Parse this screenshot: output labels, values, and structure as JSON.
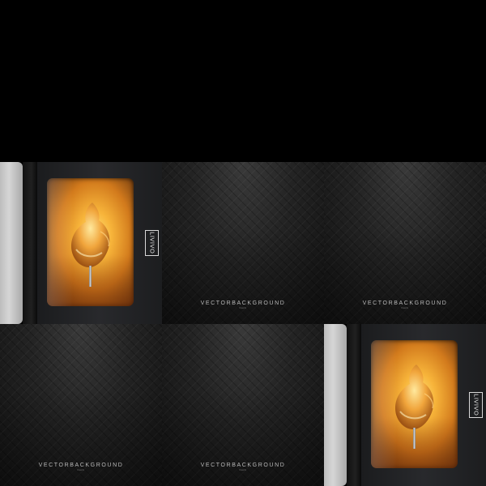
{
  "brand": {
    "logo_text": "LIVIVO"
  },
  "watermark": {
    "main": "VECTORBACKGROUND",
    "sub": "back"
  },
  "tiles": [
    {
      "kind": "oven"
    },
    {
      "kind": "background"
    },
    {
      "kind": "background"
    },
    {
      "kind": "background"
    },
    {
      "kind": "background"
    },
    {
      "kind": "oven"
    }
  ],
  "icons": [
    "oven-window-icon",
    "rotisserie-chicken-icon"
  ],
  "colors": {
    "background": "#000000",
    "panel_dark": "#232323",
    "steel": "#c8c8c8",
    "glow": "#f7b43a",
    "text_light": "#e6e6e6"
  }
}
